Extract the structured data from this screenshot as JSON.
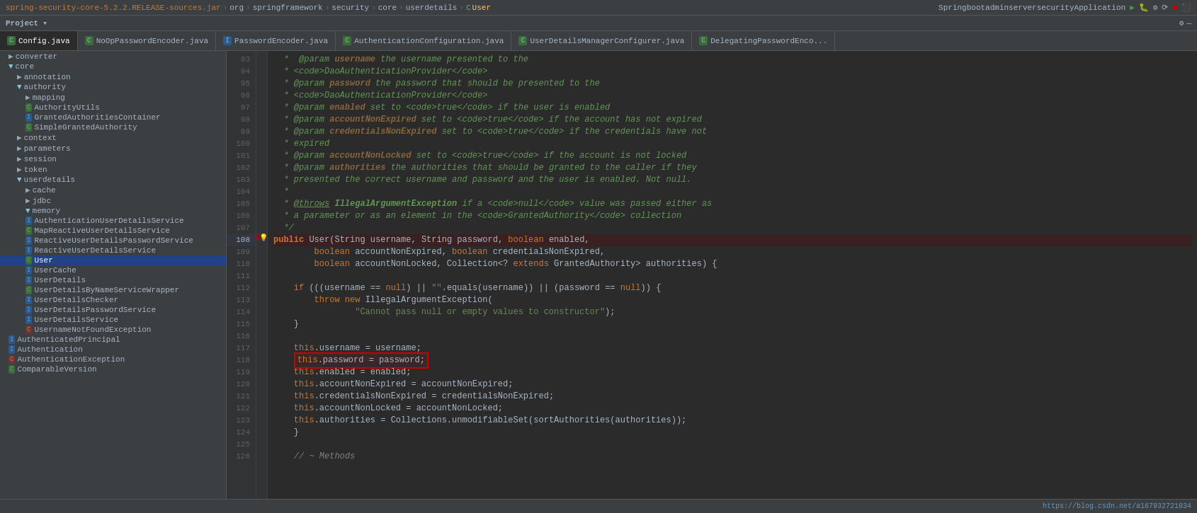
{
  "breadcrumb": {
    "jar": "spring-security-core-5.2.2.RELEASE-sources.jar",
    "org": "org",
    "springframework": "springframework",
    "security": "security",
    "core": "core",
    "userdetails": "userdetails",
    "classname": "User"
  },
  "toolbar": {
    "project_label": "Project",
    "run_config": "SpringbootadminserversecurityApplication"
  },
  "tabs": [
    {
      "label": "Config.java",
      "type": "class",
      "active": false
    },
    {
      "label": "NoOpPasswordEncoder.java",
      "type": "class",
      "active": false
    },
    {
      "label": "PasswordEncoder.java",
      "type": "interface",
      "active": false
    },
    {
      "label": "AuthenticationConfiguration.java",
      "type": "class",
      "active": false
    },
    {
      "label": "UserDetailsManagerConfigurer.java",
      "type": "class",
      "active": false
    },
    {
      "label": "DelegatingPasswordEnco...",
      "type": "class",
      "active": false
    }
  ],
  "sidebar": {
    "title": "Project",
    "items": [
      {
        "label": "converter",
        "type": "folder",
        "indent": 1,
        "expanded": false
      },
      {
        "label": "core",
        "type": "folder",
        "indent": 1,
        "expanded": true
      },
      {
        "label": "annotation",
        "type": "folder",
        "indent": 2,
        "expanded": false
      },
      {
        "label": "authority",
        "type": "folder",
        "indent": 2,
        "expanded": true
      },
      {
        "label": "mapping",
        "type": "folder",
        "indent": 3,
        "expanded": false
      },
      {
        "label": "AuthorityUtils",
        "type": "class",
        "indent": 3,
        "expanded": false
      },
      {
        "label": "GrantedAuthoritiesContainer",
        "type": "interface",
        "indent": 3,
        "expanded": false
      },
      {
        "label": "SimpleGrantedAuthority",
        "type": "class",
        "indent": 3,
        "expanded": false
      },
      {
        "label": "context",
        "type": "folder",
        "indent": 2,
        "expanded": false
      },
      {
        "label": "parameters",
        "type": "folder",
        "indent": 2,
        "expanded": false
      },
      {
        "label": "session",
        "type": "folder",
        "indent": 2,
        "expanded": false
      },
      {
        "label": "token",
        "type": "folder",
        "indent": 2,
        "expanded": false
      },
      {
        "label": "userdetails",
        "type": "folder",
        "indent": 2,
        "expanded": true
      },
      {
        "label": "cache",
        "type": "folder",
        "indent": 3,
        "expanded": false
      },
      {
        "label": "jdbc",
        "type": "folder",
        "indent": 3,
        "expanded": false
      },
      {
        "label": "memory",
        "type": "folder",
        "indent": 3,
        "expanded": true
      },
      {
        "label": "AuthenticationUserDetailsService",
        "type": "interface",
        "indent": 3,
        "expanded": false
      },
      {
        "label": "MapReactiveUserDetailsService",
        "type": "class",
        "indent": 3,
        "expanded": false
      },
      {
        "label": "ReactiveUserDetailsPasswordService",
        "type": "interface",
        "indent": 3,
        "expanded": false
      },
      {
        "label": "ReactiveUserDetailsService",
        "type": "interface",
        "indent": 3,
        "expanded": false
      },
      {
        "label": "User",
        "type": "class",
        "indent": 3,
        "expanded": false,
        "selected": true
      },
      {
        "label": "UserCache",
        "type": "interface",
        "indent": 3,
        "expanded": false
      },
      {
        "label": "UserDetails",
        "type": "interface",
        "indent": 3,
        "expanded": false
      },
      {
        "label": "UserDetailsByNameServiceWrapper",
        "type": "class",
        "indent": 3,
        "expanded": false
      },
      {
        "label": "UserDetailsChecker",
        "type": "interface",
        "indent": 3,
        "expanded": false
      },
      {
        "label": "UserDetailsPasswordService",
        "type": "interface",
        "indent": 3,
        "expanded": false
      },
      {
        "label": "UserDetailsService",
        "type": "interface",
        "indent": 3,
        "expanded": false
      },
      {
        "label": "UsernameNotFoundException",
        "type": "class",
        "indent": 3,
        "expanded": false
      },
      {
        "label": "AuthenticatedPrincipal",
        "type": "interface",
        "indent": 1,
        "expanded": false
      },
      {
        "label": "Authentication",
        "type": "interface",
        "indent": 1,
        "expanded": false
      },
      {
        "label": "AuthenticationException",
        "type": "class",
        "indent": 1,
        "expanded": false
      },
      {
        "label": "ComparableVersion",
        "type": "class",
        "indent": 1,
        "expanded": false
      }
    ]
  },
  "code": {
    "lines": [
      {
        "num": "93",
        "content": " *  @param <em>username</em> the username presented to the"
      },
      {
        "num": "94",
        "content": " * <code>DaoAuthenticationProvider</code>"
      },
      {
        "num": "95",
        "content": " * @param <em>password</em> the password that should be presented to the"
      },
      {
        "num": "96",
        "content": " * <code>DaoAuthenticationProvider</code>"
      },
      {
        "num": "97",
        "content": " * @param <em>enabled</em> set to <code>true</code> if the user is enabled"
      },
      {
        "num": "98",
        "content": " * @param <em>accountNonExpired</em> set to <code>true</code> if the account has not expired"
      },
      {
        "num": "99",
        "content": " * @param <em>credentialsNonExpired</em> set to <code>true</code> if the credentials have not"
      },
      {
        "num": "100",
        "content": " * expired"
      },
      {
        "num": "101",
        "content": " * @param <em>accountNonLocked</em> set to <code>true</code> if the account is not locked"
      },
      {
        "num": "102",
        "content": " * @param <em>authorities</em> the authorities that should be granted to the caller if they"
      },
      {
        "num": "103",
        "content": " * presented the correct username and password and the user is enabled. Not null."
      },
      {
        "num": "104",
        "content": " *"
      },
      {
        "num": "105",
        "content": " * @throws IllegalArgumentException if a <code>null</code> value was passed either as"
      },
      {
        "num": "106",
        "content": " * a parameter or as an element in the <code>GrantedAuthority</code> collection"
      },
      {
        "num": "107",
        "content": " */"
      },
      {
        "num": "108",
        "content": "public User(String username, String password, boolean enabled,",
        "hasBreakpoint": true,
        "hasLamp": true
      },
      {
        "num": "109",
        "content": "        boolean accountNonExpired, boolean credentialsNonExpired,"
      },
      {
        "num": "110",
        "content": "        boolean accountNonLocked, Collection<? extends GrantedAuthority> authorities) {"
      },
      {
        "num": "111",
        "content": ""
      },
      {
        "num": "112",
        "content": "    if (((username == null) || \"\".equals(username)) || (password == null)) {"
      },
      {
        "num": "113",
        "content": "        throw new IllegalArgumentException("
      },
      {
        "num": "114",
        "content": "                \"Cannot pass null or empty values to constructor\");"
      },
      {
        "num": "115",
        "content": "    }"
      },
      {
        "num": "116",
        "content": ""
      },
      {
        "num": "117",
        "content": "    this.username = username;"
      },
      {
        "num": "118",
        "content": "    this.password = password;",
        "highlighted": true
      },
      {
        "num": "119",
        "content": "    this.enabled = enabled;"
      },
      {
        "num": "120",
        "content": "    this.accountNonExpired = accountNonExpired;"
      },
      {
        "num": "121",
        "content": "    this.credentialsNonExpired = credentialsNonExpired;"
      },
      {
        "num": "122",
        "content": "    this.accountNonLocked = accountNonLocked;"
      },
      {
        "num": "123",
        "content": "    this.authorities = Collections.unmodifiableSet(sortAuthorities(authorities));"
      },
      {
        "num": "124",
        "content": "    }"
      },
      {
        "num": "125",
        "content": ""
      },
      {
        "num": "126",
        "content": "    // ~ Methods"
      }
    ]
  },
  "status_bar": {
    "url": "https://blog.csdn.net/a167932721834"
  }
}
